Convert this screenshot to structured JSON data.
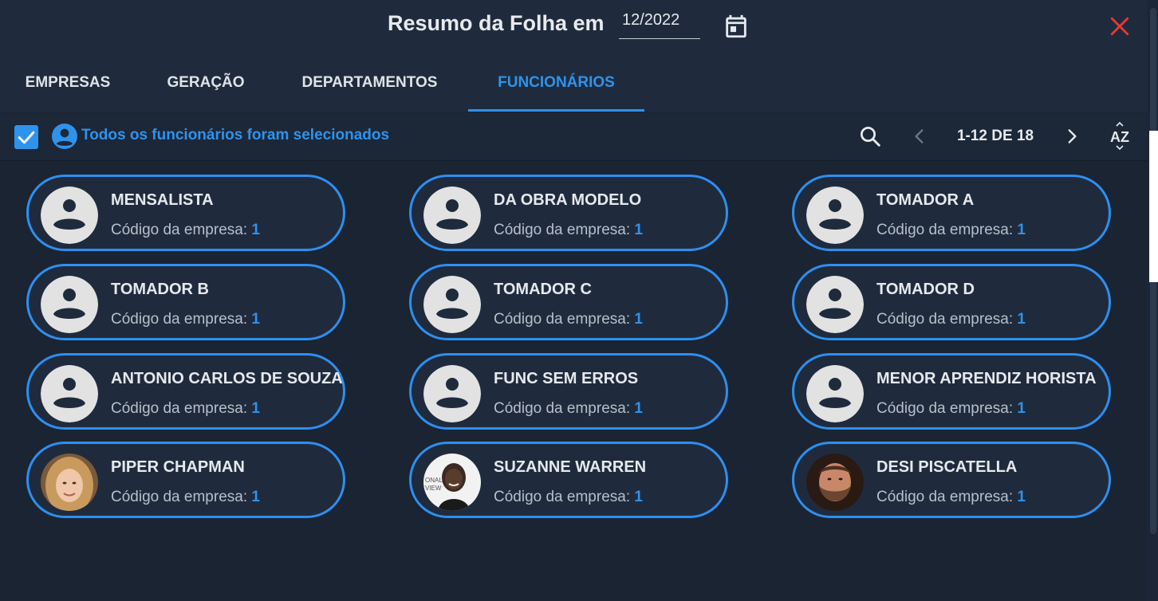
{
  "header": {
    "title": "Resumo da Folha em",
    "date_value": "12/2022"
  },
  "tabs": [
    {
      "label": "EMPRESAS"
    },
    {
      "label": "GERAÇÃO"
    },
    {
      "label": "DEPARTAMENTOS"
    },
    {
      "label": "FUNCIONÁRIOS",
      "active": true
    }
  ],
  "toolbar": {
    "selection_text": "Todos os funcionários foram selecionados",
    "pagination": "1-12 DE 18",
    "sort_label": "AZ"
  },
  "employees": [
    {
      "name": "MENSALISTA",
      "code_label": "Código da empresa:",
      "code": "1",
      "avatar": "placeholder"
    },
    {
      "name": "DA OBRA MODELO",
      "code_label": "Código da empresa:",
      "code": "1",
      "avatar": "placeholder"
    },
    {
      "name": "TOMADOR A",
      "code_label": "Código da empresa:",
      "code": "1",
      "avatar": "placeholder"
    },
    {
      "name": "TOMADOR B",
      "code_label": "Código da empresa:",
      "code": "1",
      "avatar": "placeholder"
    },
    {
      "name": "TOMADOR C",
      "code_label": "Código da empresa:",
      "code": "1",
      "avatar": "placeholder"
    },
    {
      "name": "TOMADOR D",
      "code_label": "Código da empresa:",
      "code": "1",
      "avatar": "placeholder"
    },
    {
      "name": "ANTONIO CARLOS DE SOUZA",
      "code_label": "Código da empresa:",
      "code": "1",
      "avatar": "placeholder"
    },
    {
      "name": "FUNC SEM ERROS",
      "code_label": "Código da empresa:",
      "code": "1",
      "avatar": "placeholder"
    },
    {
      "name": "MENOR APRENDIZ HORISTA",
      "code_label": "Código da empresa:",
      "code": "1",
      "avatar": "placeholder"
    },
    {
      "name": "PIPER CHAPMAN",
      "code_label": "Código da empresa:",
      "code": "1",
      "avatar": "photo-blonde"
    },
    {
      "name": "SUZANNE WARREN",
      "code_label": "Código da empresa:",
      "code": "1",
      "avatar": "photo-dark"
    },
    {
      "name": "DESI PISCATELLA",
      "code_label": "Código da empresa:",
      "code": "1",
      "avatar": "photo-bearded"
    }
  ],
  "colors": {
    "accent": "#2e93ec",
    "background": "#1a2433",
    "card": "#1f2b3d",
    "close": "#e53935"
  }
}
